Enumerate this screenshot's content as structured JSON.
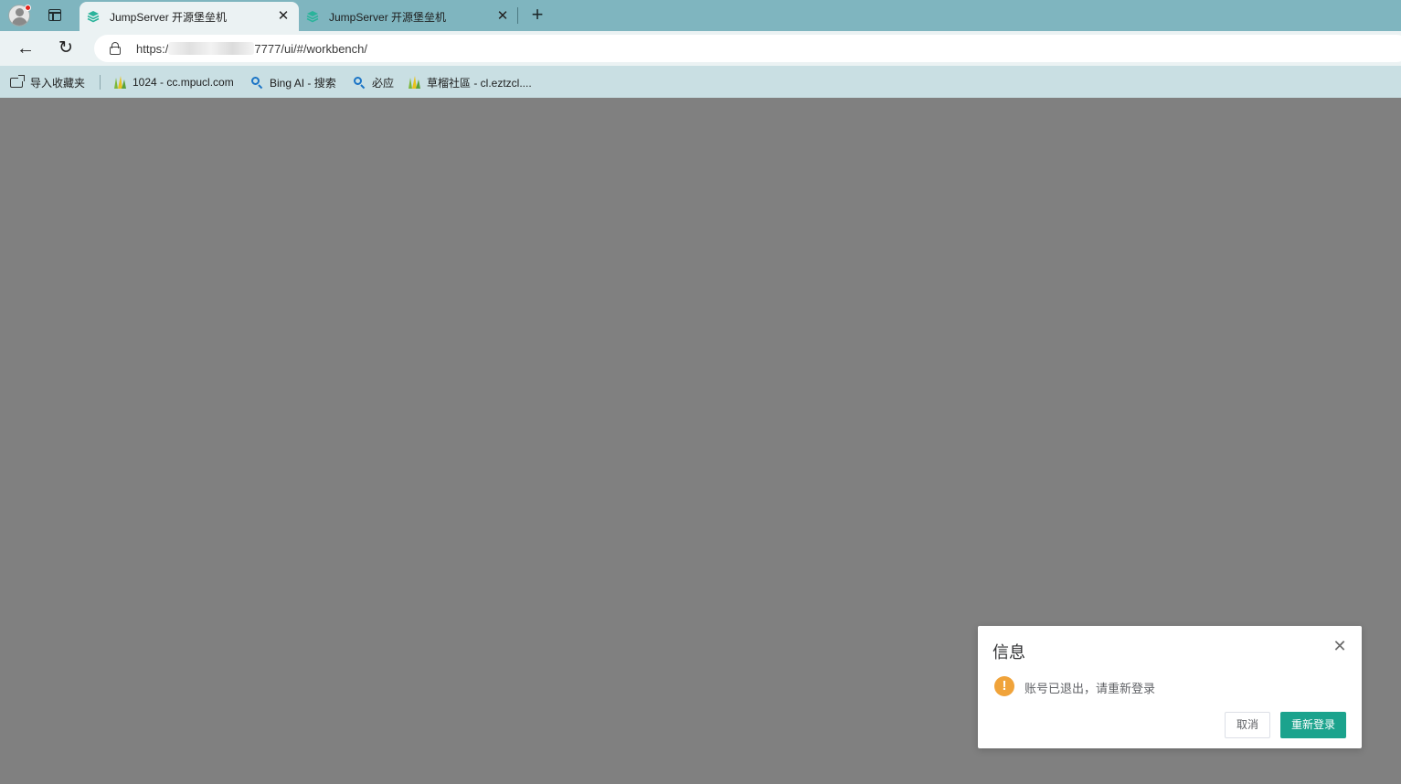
{
  "browser": {
    "tabs": [
      {
        "title": "JumpServer 开源堡垒机",
        "active": true
      },
      {
        "title": "JumpServer 开源堡垒机",
        "active": false
      }
    ],
    "new_tab_glyph": "+",
    "close_glyph": "✕",
    "back_glyph": "←",
    "reload_glyph": "↻",
    "address": {
      "prefix": "https:/",
      "suffix": "7777/ui/#/workbench/"
    }
  },
  "bookmarks": [
    {
      "label": "导入收藏夹",
      "icon": "import-favorites-icon"
    },
    {
      "label": "1024 - cc.mpucl.com",
      "icon": "grass-icon"
    },
    {
      "label": "Bing AI - 搜索",
      "icon": "search-icon"
    },
    {
      "label": "必应",
      "icon": "search-icon"
    },
    {
      "label": "草榴社區 - cl.eztzcl....",
      "icon": "grass-icon"
    }
  ],
  "dialog": {
    "title": "信息",
    "message": "账号已退出，请重新登录",
    "cancel_label": "取消",
    "confirm_label": "重新登录",
    "warning_glyph": "!",
    "close_glyph": "✕"
  },
  "colors": {
    "tabstrip": "#7fb5bf",
    "toolbar": "#ebf2f3",
    "bookmarks_bar": "#c9dfe3",
    "overlay": "#808080",
    "warning": "#f0a33a",
    "primary_button": "#1ba38d"
  }
}
